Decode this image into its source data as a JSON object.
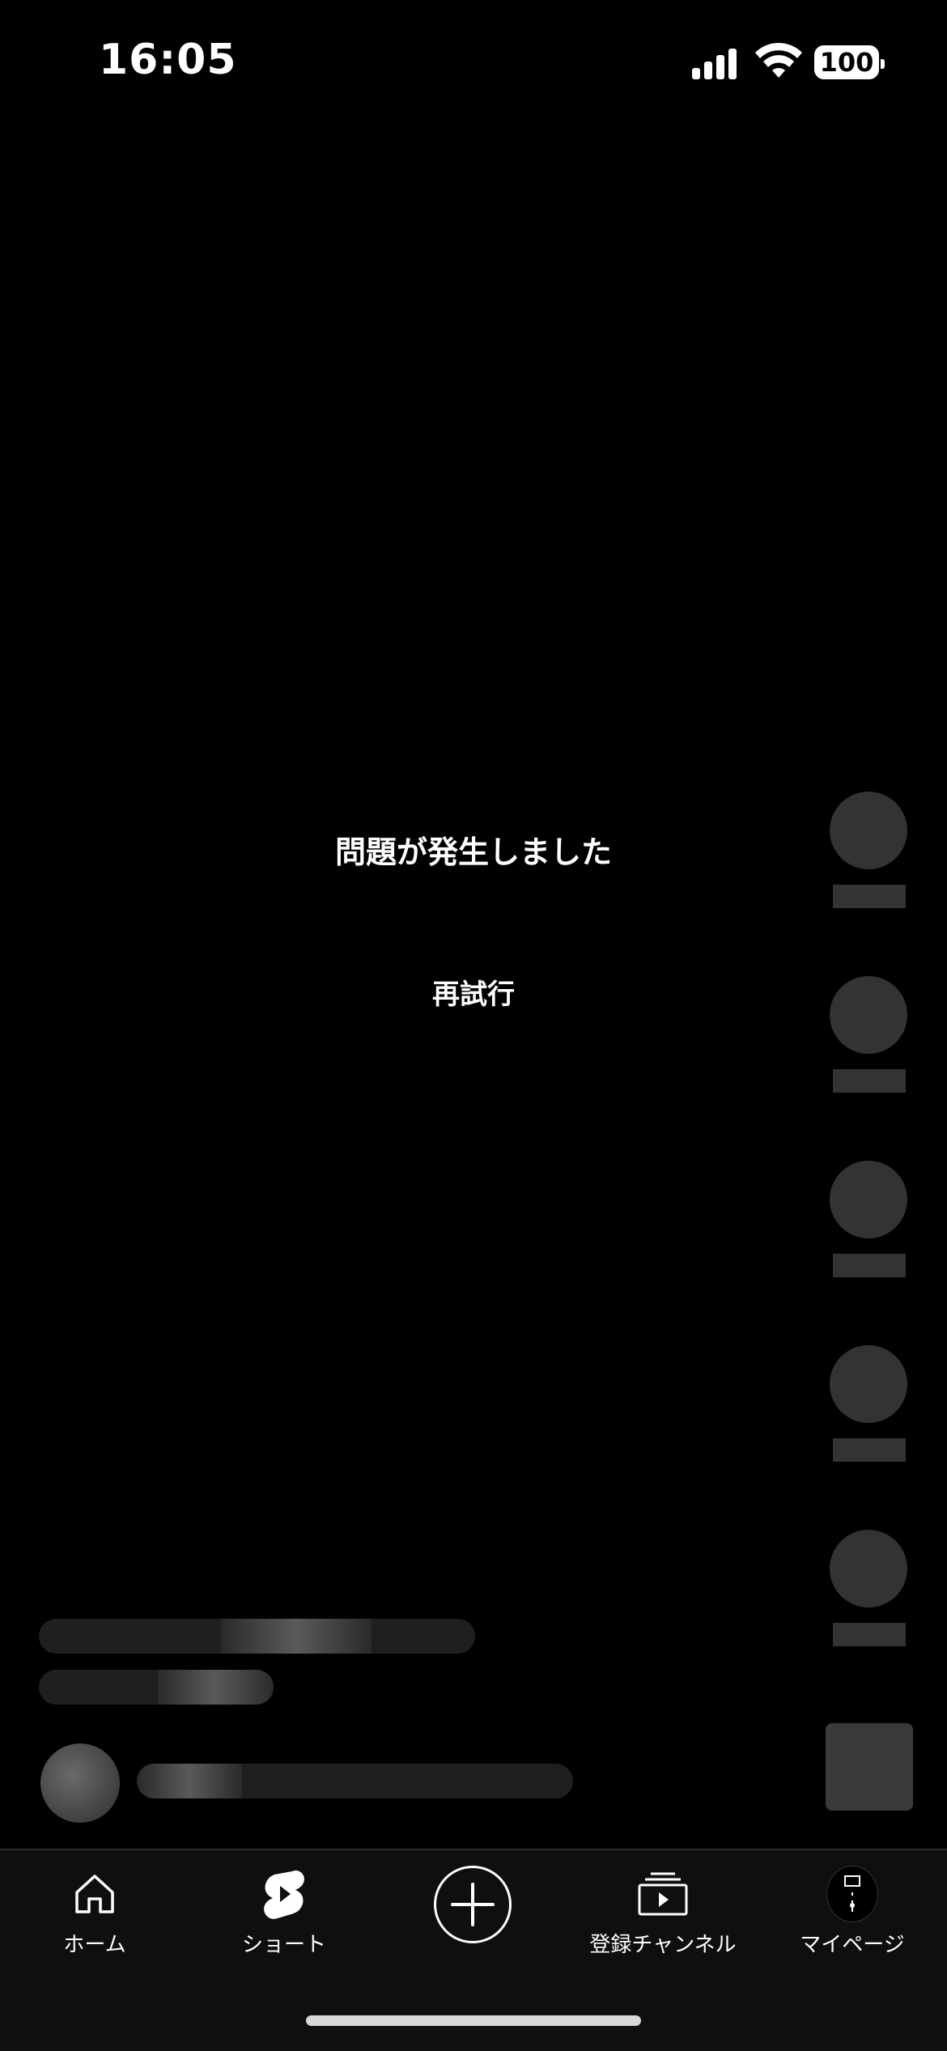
{
  "status_bar": {
    "time": "16:05",
    "battery": "100"
  },
  "error": {
    "message": "問題が発生しました",
    "retry_label": "再試行"
  },
  "tabbar": {
    "items": [
      {
        "label": "ホーム",
        "icon": "home-icon"
      },
      {
        "label": "ショート",
        "icon": "shorts-icon"
      },
      {
        "label": "",
        "icon": "plus-icon"
      },
      {
        "label": "登録チャンネル",
        "icon": "subscriptions-icon"
      },
      {
        "label": "マイページ",
        "icon": "avatar-icon"
      }
    ]
  },
  "colors": {
    "background": "#000000",
    "skeleton": "#333333",
    "tabbar": "#0f0f0f",
    "text": "#ffffff"
  }
}
